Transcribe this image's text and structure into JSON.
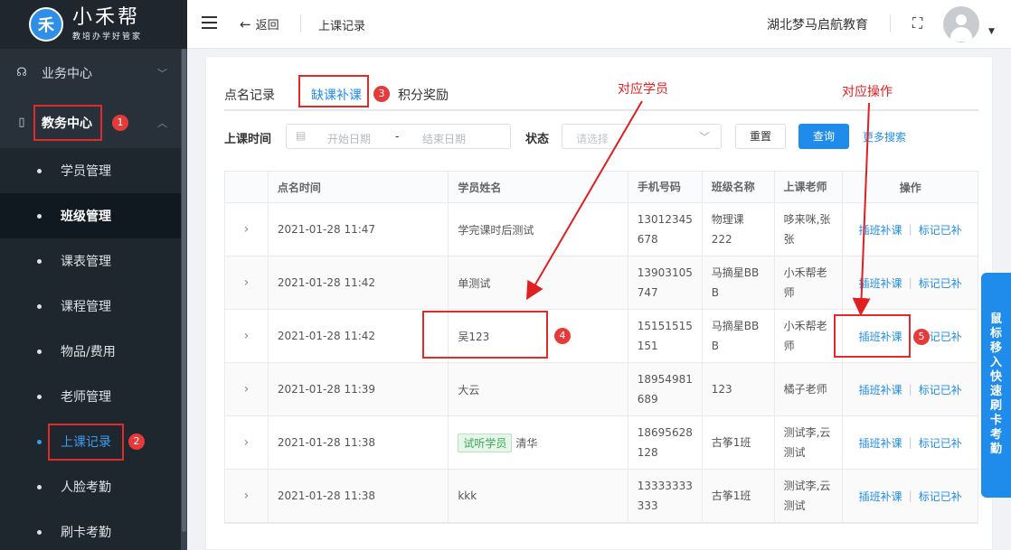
{
  "sidebar": {
    "logo_mark": "禾",
    "logo_name": "小禾帮",
    "logo_tagline": "教培办学好管家",
    "groups": [
      {
        "label": "业务中心",
        "icon": "headset-icon"
      },
      {
        "label": "教务中心",
        "icon": "book-icon"
      }
    ],
    "items": [
      {
        "label": "学员管理"
      },
      {
        "label": "班级管理"
      },
      {
        "label": "课表管理"
      },
      {
        "label": "课程管理"
      },
      {
        "label": "物品/费用"
      },
      {
        "label": "老师管理"
      },
      {
        "label": "上课记录"
      },
      {
        "label": "人脸考勤"
      },
      {
        "label": "刷卡考勤"
      }
    ]
  },
  "header": {
    "back_label": "返回",
    "breadcrumb": "上课记录",
    "org_name": "湖北梦马启航教育"
  },
  "tabs": [
    {
      "label": "点名记录"
    },
    {
      "label": "缺课补课"
    },
    {
      "label": "积分奖励"
    }
  ],
  "filter": {
    "time_label": "上课时间",
    "start_placeholder": "开始日期",
    "separator": "-",
    "end_placeholder": "结束日期",
    "status_label": "状态",
    "status_placeholder": "请选择",
    "reset_label": "重置",
    "query_label": "查询",
    "more_label": "更多搜索"
  },
  "table": {
    "headers": [
      "点名时间",
      "学员姓名",
      "手机号码",
      "班级名称",
      "上课老师",
      "操作"
    ],
    "rows": [
      {
        "time": "2021-01-28 11:47",
        "tag": "",
        "name": "学完课时后测试",
        "phone_a": "13012345",
        "phone_b": "678",
        "class_a": "物理课222",
        "class_b": "",
        "teacher_a": "哆来咪,张",
        "teacher_b": "张"
      },
      {
        "time": "2021-01-28 11:42",
        "tag": "",
        "name": "单测试",
        "phone_a": "13903105",
        "phone_b": "747",
        "class_a": "马摘星BB",
        "class_b": "B",
        "teacher_a": "小禾帮老",
        "teacher_b": "师"
      },
      {
        "time": "2021-01-28 11:42",
        "tag": "",
        "name": "吴123",
        "phone_a": "15151515",
        "phone_b": "151",
        "class_a": "马摘星BB",
        "class_b": "B",
        "teacher_a": "小禾帮老",
        "teacher_b": "师"
      },
      {
        "time": "2021-01-28 11:39",
        "tag": "",
        "name": "大云",
        "phone_a": "18954981",
        "phone_b": "689",
        "class_a": "123",
        "class_b": "",
        "teacher_a": "橘子老师",
        "teacher_b": ""
      },
      {
        "time": "2021-01-28 11:38",
        "tag": "试听学员",
        "name": "清华",
        "phone_a": "18695628",
        "phone_b": "128",
        "class_a": "古筝1班",
        "class_b": "",
        "teacher_a": "测试李,云",
        "teacher_b": "测试"
      },
      {
        "time": "2021-01-28 11:38",
        "tag": "",
        "name": "kkk",
        "phone_a": "13333333",
        "phone_b": "333",
        "class_a": "古筝1班",
        "class_b": "",
        "teacher_a": "测试李,云",
        "teacher_b": "测试"
      }
    ],
    "op_makeup": "插班补课",
    "op_mark": "标记已补"
  },
  "float_button": {
    "label": "鼠标移入 快速刷卡考勤"
  },
  "annotations": {
    "student_label": "对应学员",
    "operation_label": "对应操作",
    "badges": [
      "1",
      "2",
      "3",
      "4",
      "5"
    ],
    "color": "#e02020"
  },
  "colors": {
    "accent": "#1f8ceb",
    "sidebar_bg": "#28313a",
    "annotation": "#e02020"
  }
}
